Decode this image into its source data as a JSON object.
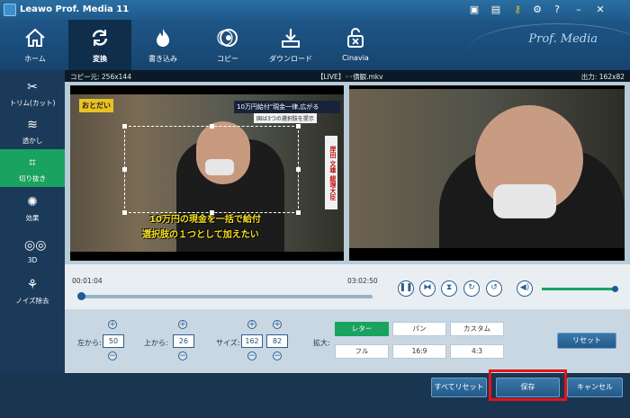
{
  "app": {
    "title": "Leawo Prof. Media 11",
    "brand": "Prof. Media"
  },
  "titlebar_icons": [
    "register-icon",
    "chat-icon",
    "key-icon",
    "gear-icon",
    "help-icon",
    "minimize-icon",
    "close-icon"
  ],
  "toolbar": {
    "items": [
      {
        "label": "ホーム",
        "icon": "home-icon"
      },
      {
        "label": "変換",
        "icon": "convert-icon"
      },
      {
        "label": "書き込み",
        "icon": "burn-icon"
      },
      {
        "label": "コピー",
        "icon": "copy-disc-icon"
      },
      {
        "label": "ダウンロード",
        "icon": "download-icon"
      },
      {
        "label": "Cinavia",
        "icon": "cinavia-icon"
      }
    ],
    "active": "変換"
  },
  "sidebar": {
    "items": [
      {
        "label": "トリム(カット)",
        "icon": "scissors-icon"
      },
      {
        "label": "透かし",
        "icon": "watermark-icon"
      },
      {
        "label": "切り抜き",
        "icon": "crop-icon"
      },
      {
        "label": "効果",
        "icon": "effect-icon"
      },
      {
        "label": "3D",
        "icon": "3d-glasses-icon"
      },
      {
        "label": "ノイズ除去",
        "icon": "denoise-icon"
      }
    ],
    "active": "切り抜き"
  },
  "infobar": {
    "source": "コピー元: 256x144",
    "file": "【LIVE】◦◦債観.mkv",
    "output": "出力: 162x82"
  },
  "video": {
    "badge": "おとだい",
    "headline": "10万円給付\"現金一律,広がる",
    "subline": "国は3つの選択肢を提示",
    "name_tag": "岸田 文雄 総理大臣",
    "subtitle_line1": "10万円の現金を一括で給付",
    "subtitle_line2": "選択肢の１つとして加えたい"
  },
  "playback": {
    "current_time": "00:01:04",
    "total_time": "03:02:50",
    "progress": 0.0,
    "volume": 1.0
  },
  "crop": {
    "left_label": "左から:",
    "left_value": "50",
    "top_label": "上から:",
    "top_value": "26",
    "size_label": "サイズ:",
    "width_value": "162",
    "height_value": "82",
    "zoom_label": "拡大:",
    "zoom_options": [
      "レター",
      "パン",
      "カスタム",
      "フル",
      "16:9",
      "4:3"
    ],
    "zoom_selected": "レター",
    "reset_label": "リセット"
  },
  "footer": {
    "reset_all": "すべてリセット",
    "save": "保存",
    "cancel": "キャンセル"
  },
  "colors": {
    "accent_green": "#1aa260",
    "highlight_red": "#e0161b",
    "titlebar_blue": "#2a6ea2"
  }
}
